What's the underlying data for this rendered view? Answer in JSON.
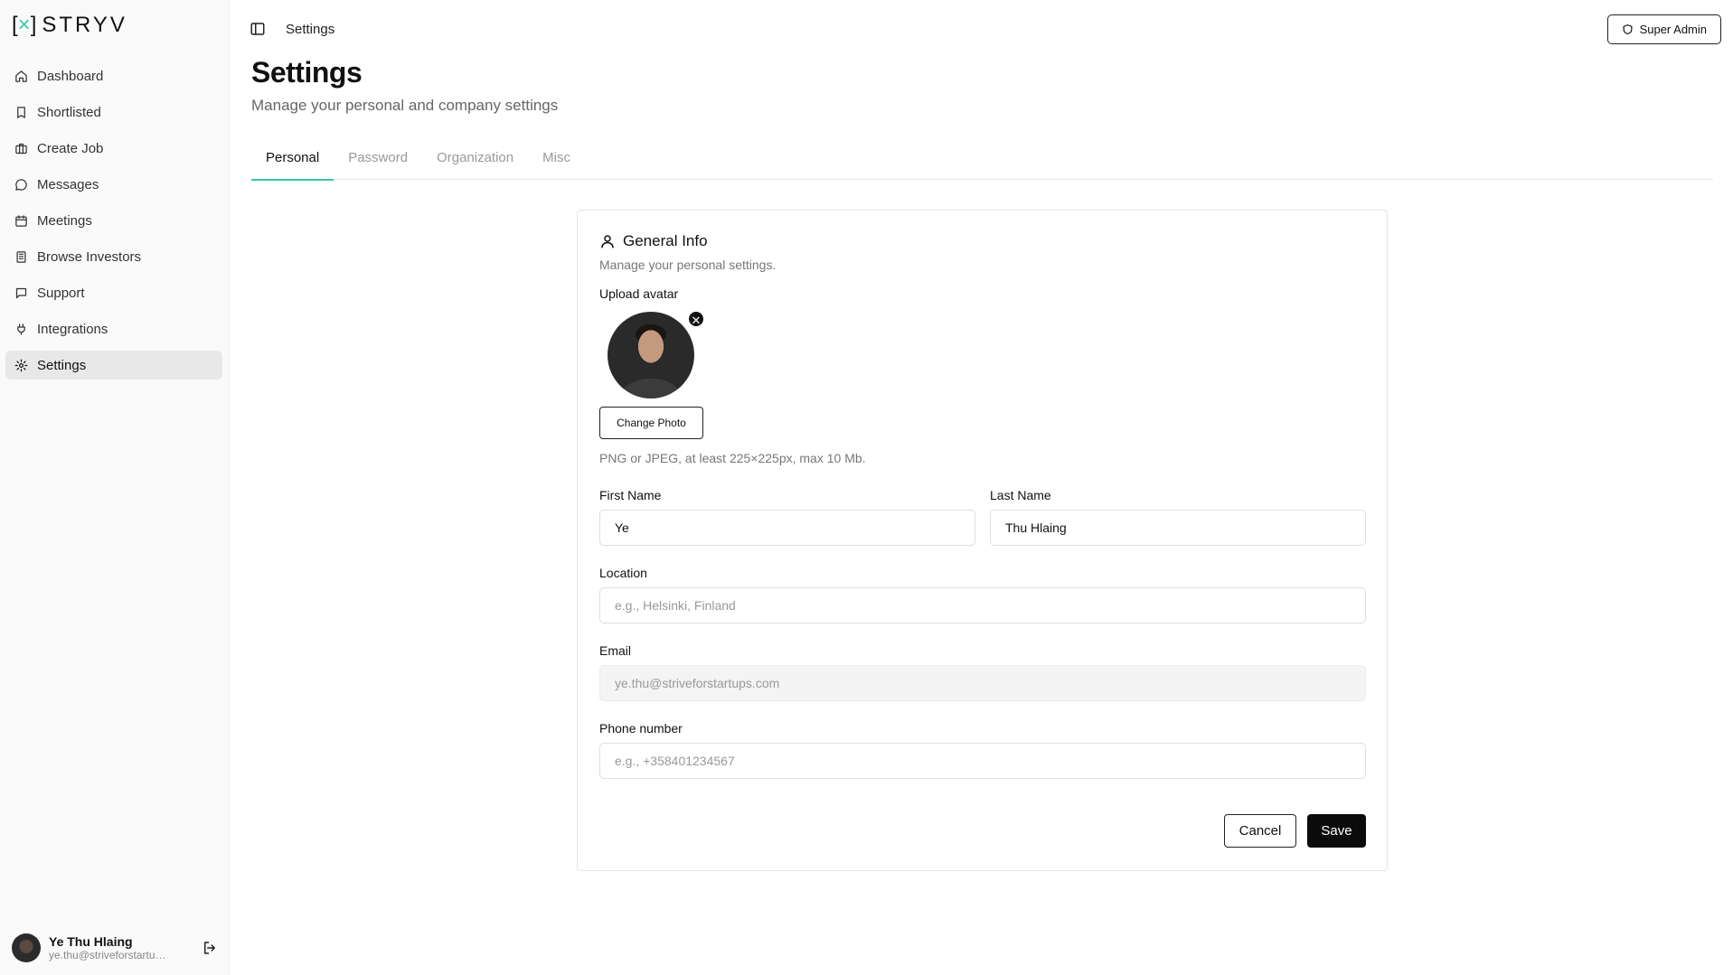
{
  "brand": {
    "logo_mark": "[×]",
    "logo_text": "STRYV",
    "accent": "#35c8a8"
  },
  "sidebar": {
    "items": [
      {
        "label": "Dashboard",
        "icon": "home-icon"
      },
      {
        "label": "Shortlisted",
        "icon": "bookmark-icon"
      },
      {
        "label": "Create Job",
        "icon": "briefcase-icon"
      },
      {
        "label": "Messages",
        "icon": "message-circle-icon"
      },
      {
        "label": "Meetings",
        "icon": "calendar-icon"
      },
      {
        "label": "Browse Investors",
        "icon": "building-icon"
      },
      {
        "label": "Support",
        "icon": "message-square-icon"
      },
      {
        "label": "Integrations",
        "icon": "plug-icon"
      },
      {
        "label": "Settings",
        "icon": "gear-icon",
        "active": true
      }
    ],
    "user": {
      "name": "Ye Thu Hlaing",
      "email": "ye.thu@striveforstartups.com"
    }
  },
  "header": {
    "breadcrumb": "Settings",
    "role_button": "Super Admin"
  },
  "page": {
    "title": "Settings",
    "subtitle": "Manage your personal and company settings",
    "tabs": [
      "Personal",
      "Password",
      "Organization",
      "Misc"
    ],
    "active_tab": "Personal"
  },
  "card": {
    "title": "General Info",
    "subtitle": "Manage your personal settings.",
    "avatar_label": "Upload avatar",
    "change_photo": "Change Photo",
    "avatar_hint": "PNG or JPEG, at least 225×225px, max 10 Mb.",
    "first_name": {
      "label": "First Name",
      "value": "Ye"
    },
    "last_name": {
      "label": "Last Name",
      "value": "Thu Hlaing"
    },
    "location": {
      "label": "Location",
      "value": "",
      "placeholder": "e.g., Helsinki, Finland"
    },
    "email": {
      "label": "Email",
      "value": "ye.thu@striveforstartups.com"
    },
    "phone": {
      "label": "Phone number",
      "value": "",
      "placeholder": "e.g., +358401234567"
    },
    "cancel": "Cancel",
    "save": "Save"
  }
}
